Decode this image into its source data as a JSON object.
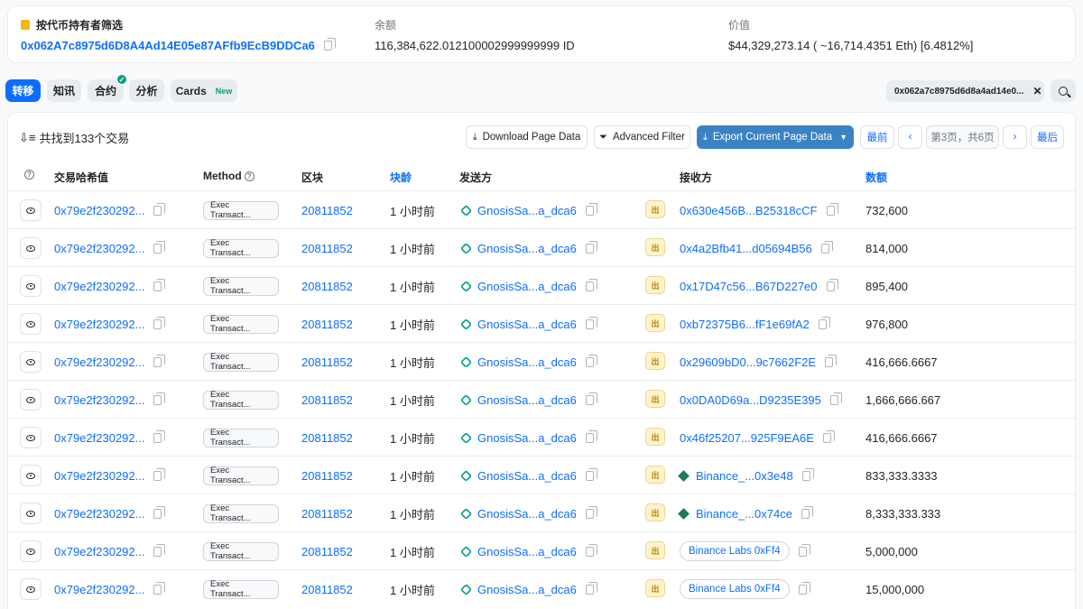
{
  "token_filter": {
    "label": "按代币持有者筛选",
    "address": "0x062A7c8975d6D8A4Ad14E05e87AFfb9EcB9DDCa6"
  },
  "balance": {
    "label": "余额",
    "value": "116,384,622.012100002999999999 ID"
  },
  "worth": {
    "label": "价值",
    "value": "$44,329,273.14 ( ~16,714.4351 Eth) [6.4812%]"
  },
  "tabs": [
    {
      "label": "转移"
    },
    {
      "label": "知讯"
    },
    {
      "label": "合约"
    },
    {
      "label": "分析"
    },
    {
      "label": "Cards",
      "badge": "New"
    }
  ],
  "filter_pill": {
    "text": "0x062a7c8975d6d8a4ad14e0..."
  },
  "summary": "共找到133个交易",
  "buttons": {
    "download": "Download Page Data",
    "advanced": "Advanced Filter",
    "export": "Export Current Page Data",
    "first": "最前",
    "page_info": "第3页，共6页",
    "last": "最后"
  },
  "headers": {
    "hash": "交易哈希值",
    "method": "Method",
    "block": "区块",
    "age": "块龄",
    "from": "发送方",
    "to": "接收方",
    "amount": "数额"
  },
  "out_badge": "出",
  "rows": [
    {
      "hash": "0x79e2f230292...",
      "method": "Exec Transact...",
      "block": "20811852",
      "age": "1 小时前",
      "from": "GnosisSa...a_dca6",
      "to": "0x630e456B...B25318cCF",
      "to_type": "addr",
      "amount": "732,600"
    },
    {
      "hash": "0x79e2f230292...",
      "method": "Exec Transact...",
      "block": "20811852",
      "age": "1 小时前",
      "from": "GnosisSa...a_dca6",
      "to": "0x4a2Bfb41...d05694B56",
      "to_type": "addr",
      "amount": "814,000"
    },
    {
      "hash": "0x79e2f230292...",
      "method": "Exec Transact...",
      "block": "20811852",
      "age": "1 小时前",
      "from": "GnosisSa...a_dca6",
      "to": "0x17D47c56...B67D227e0",
      "to_type": "addr",
      "amount": "895,400"
    },
    {
      "hash": "0x79e2f230292...",
      "method": "Exec Transact...",
      "block": "20811852",
      "age": "1 小时前",
      "from": "GnosisSa...a_dca6",
      "to": "0xb72375B6...fF1e69fA2",
      "to_type": "addr",
      "amount": "976,800"
    },
    {
      "hash": "0x79e2f230292...",
      "method": "Exec Transact...",
      "block": "20811852",
      "age": "1 小时前",
      "from": "GnosisSa...a_dca6",
      "to": "0x29609bD0...9c7662F2E",
      "to_type": "addr",
      "amount": "416,666.6667"
    },
    {
      "hash": "0x79e2f230292...",
      "method": "Exec Transact...",
      "block": "20811852",
      "age": "1 小时前",
      "from": "GnosisSa...a_dca6",
      "to": "0x0DA0D69a...D9235E395",
      "to_type": "addr",
      "amount": "1,666,666.667"
    },
    {
      "hash": "0x79e2f230292...",
      "method": "Exec Transact...",
      "block": "20811852",
      "age": "1 小时前",
      "from": "GnosisSa...a_dca6",
      "to": "0x46f25207...925F9EA6E",
      "to_type": "addr",
      "amount": "416,666.6667"
    },
    {
      "hash": "0x79e2f230292...",
      "method": "Exec Transact...",
      "block": "20811852",
      "age": "1 小时前",
      "from": "GnosisSa...a_dca6",
      "to": "Binance_...0x3e48",
      "to_type": "contract",
      "amount": "833,333.3333"
    },
    {
      "hash": "0x79e2f230292...",
      "method": "Exec Transact...",
      "block": "20811852",
      "age": "1 小时前",
      "from": "GnosisSa...a_dca6",
      "to": "Binance_...0x74ce",
      "to_type": "contract",
      "amount": "8,333,333.333"
    },
    {
      "hash": "0x79e2f230292...",
      "method": "Exec Transact...",
      "block": "20811852",
      "age": "1 小时前",
      "from": "GnosisSa...a_dca6",
      "to": "Binance Labs 0xFf4",
      "to_type": "label",
      "amount": "5,000,000"
    },
    {
      "hash": "0x79e2f230292...",
      "method": "Exec Transact...",
      "block": "20811852",
      "age": "1 小时前",
      "from": "GnosisSa...a_dca6",
      "to": "Binance Labs 0xFf4",
      "to_type": "label",
      "amount": "15,000,000"
    }
  ]
}
